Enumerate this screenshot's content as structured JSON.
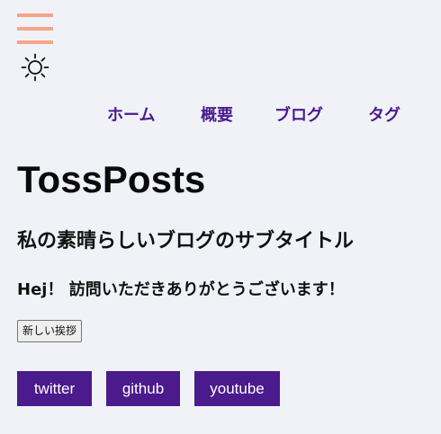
{
  "nav": {
    "items": [
      {
        "label": "ホーム"
      },
      {
        "label": "概要"
      },
      {
        "label": "ブログ"
      },
      {
        "label": "タグ"
      }
    ]
  },
  "site": {
    "title": "TossPosts",
    "subtitle": "私の素晴らしいブログのサブタイトル"
  },
  "greeting": {
    "text": "Hej！ 訪問いただきありがとうございます！",
    "button_label": "新しい挨拶"
  },
  "social": [
    {
      "label": "twitter"
    },
    {
      "label": "github"
    },
    {
      "label": "youtube"
    }
  ],
  "icons": {
    "menu": "hamburger-menu-icon",
    "theme": "sun-icon"
  },
  "colors": {
    "accent": "#4b1a8c",
    "menu_icon": "#f5a58a",
    "background": "#f0f2f8"
  }
}
